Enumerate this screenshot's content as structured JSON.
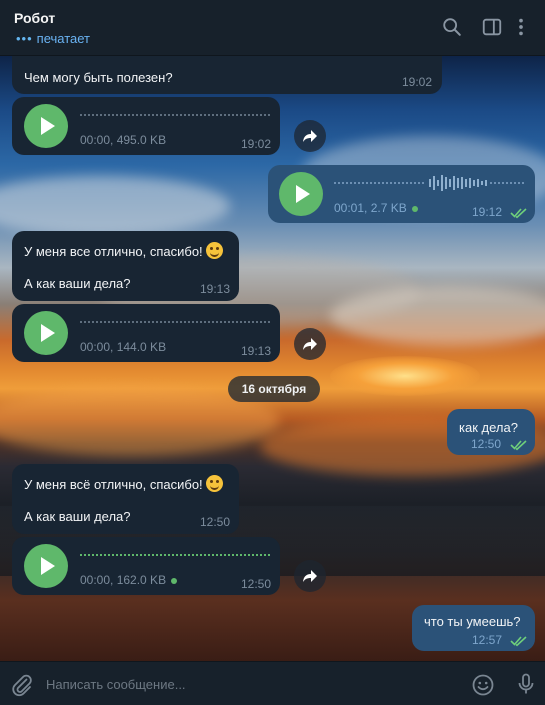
{
  "header": {
    "title": "Робот",
    "status": "печатает"
  },
  "messages": [
    {
      "dir": "in",
      "type": "text",
      "lines": [
        "Чем могу быть полезен?"
      ],
      "time": "19:02"
    },
    {
      "dir": "in",
      "type": "voice",
      "meta": "00:00, 495.0 KB",
      "time": "19:02"
    },
    {
      "dir": "out",
      "type": "voice",
      "meta": "00:01, 2.7 KB",
      "time": "19:12"
    },
    {
      "dir": "in",
      "type": "text",
      "lines": [
        "У меня все отлично, спасибо!",
        "А как ваши дела?"
      ],
      "time": "19:13"
    },
    {
      "dir": "in",
      "type": "voice",
      "meta": "00:00, 144.0 KB",
      "time": "19:13"
    },
    {
      "dir": "out",
      "type": "text",
      "lines": [
        "как дела?"
      ],
      "time": "12:50"
    },
    {
      "dir": "in",
      "type": "text",
      "lines": [
        "У меня всё отлично, спасибо!",
        "А как ваши дела?"
      ],
      "time": "12:50"
    },
    {
      "dir": "in",
      "type": "voice",
      "meta": "00:00, 162.0 KB",
      "time": "12:50"
    },
    {
      "dir": "out",
      "type": "text",
      "lines": [
        "что ты умеешь?"
      ],
      "time": "12:57"
    }
  ],
  "date_separator": "16 октября",
  "composer": {
    "placeholder": "Написать сообщение..."
  },
  "icons": [
    "search-icon",
    "sidebar-toggle-icon",
    "more-vertical-icon",
    "attach-icon",
    "emoji-icon",
    "microphone-icon",
    "forward-icon",
    "play-icon",
    "double-check-icon"
  ],
  "colors": {
    "incoming_bubble": "#182533",
    "outgoing_bubble": "#2b5278",
    "accent_green": "#5fb86b",
    "status_blue": "#6ab3f3"
  }
}
